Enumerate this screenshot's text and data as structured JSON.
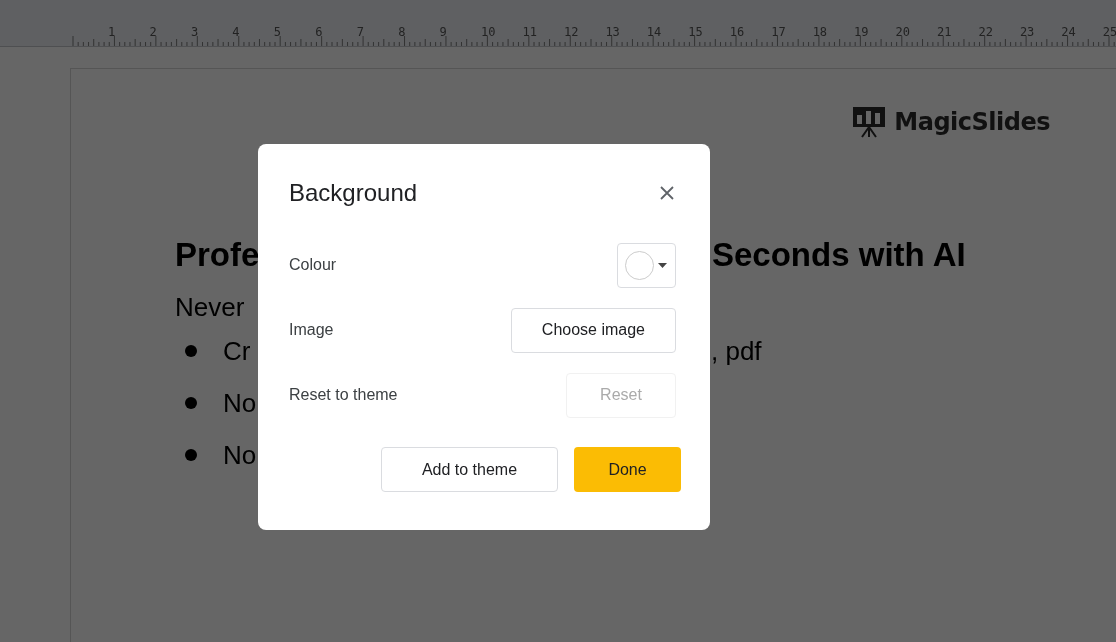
{
  "ruler": {
    "numbers": [
      "1",
      "2",
      "3",
      "4",
      "5",
      "6",
      "7",
      "8",
      "9",
      "10",
      "11",
      "12",
      "13",
      "14",
      "15",
      "16",
      "17",
      "18",
      "19",
      "20",
      "21",
      "22",
      "23",
      "24",
      "25"
    ]
  },
  "slide": {
    "logo": "MagicSlides",
    "title": {
      "left": "Profe",
      "right": "Seconds with AI"
    },
    "subtitle": "Never",
    "bullets": [
      {
        "left": "Cr",
        "right": ", pdf"
      },
      {
        "left": "No"
      },
      {
        "left": "No"
      }
    ]
  },
  "dialog": {
    "title": "Background",
    "rows": [
      {
        "kind": "color",
        "label": "Colour",
        "color": "#ffffff"
      },
      {
        "kind": "button",
        "label": "Image",
        "button": "Choose image",
        "disabled": false
      },
      {
        "kind": "button",
        "label": "Reset to theme",
        "button": "Reset",
        "disabled": true
      }
    ],
    "buttons": [
      {
        "label": "Add to theme",
        "kind": "secondary"
      },
      {
        "label": "Done",
        "kind": "primary"
      }
    ]
  }
}
